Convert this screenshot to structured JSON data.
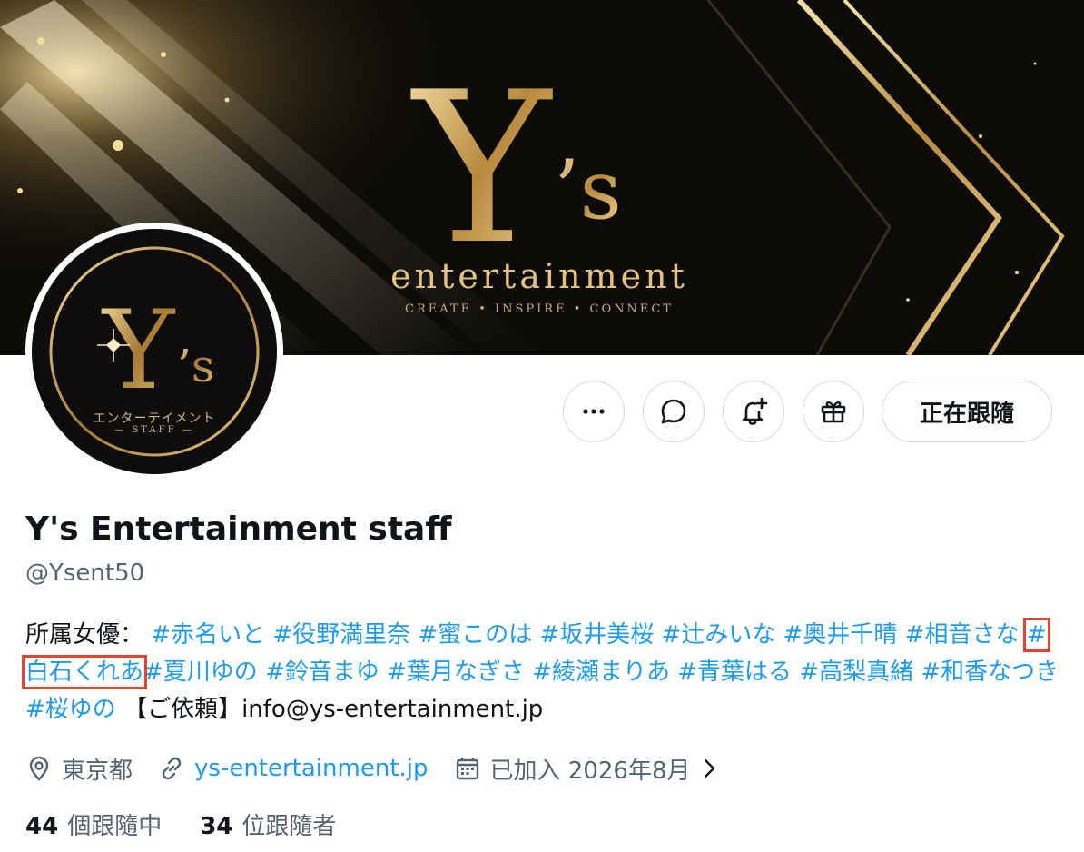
{
  "banner": {
    "brand_mark": "Y's",
    "brand_word": "entertainment",
    "brand_tagline": "CREATE • INSPIRE • CONNECT"
  },
  "avatar": {
    "mark": "Y's",
    "kana": "エンターテイメント",
    "staff": "— STAFF —"
  },
  "actions": {
    "more_icon": "more-horizontal-icon",
    "message_icon": "message-bubble-icon",
    "notify_icon": "bell-plus-icon",
    "subscribe_icon": "gift-icon",
    "follow_label": "正在跟隨"
  },
  "profile": {
    "display_name": "Y's Entertainment staff",
    "handle": "@Ysent50"
  },
  "bio": {
    "prefix": "所属女優：",
    "hashtags": [
      "#赤名いと",
      "#役野満里奈",
      "#蜜このは",
      "#坂井美桜",
      "#辻みいな",
      "#奥井千晴",
      "#相音さな",
      "#白石くれあ",
      "#夏川ゆの",
      "#鈴音まゆ",
      "#葉月なぎさ",
      "#綾瀬まりあ",
      "#青葉はる",
      "#高梨真緒",
      "#和香なつき",
      "#桜ゆの"
    ],
    "highlighted_tag": "#白石くれあ",
    "suffix": "【ご依頼】info@ys-entertainment.jp"
  },
  "meta": {
    "location_icon": "location-pin-icon",
    "location": "東京都",
    "link_icon": "link-icon",
    "website": "ys-entertainment.jp",
    "calendar_icon": "calendar-icon",
    "joined": "已加入 2026年8月",
    "chevron_icon": "chevron-right-icon"
  },
  "stats": {
    "following_count": "44",
    "following_label": "個跟隨中",
    "followers_count": "34",
    "followers_label": "位跟隨者"
  },
  "colors": {
    "link": "#1d9bf0",
    "highlight_box": "#e5432d",
    "muted_text": "#536471",
    "gold": "#d9b46a"
  }
}
